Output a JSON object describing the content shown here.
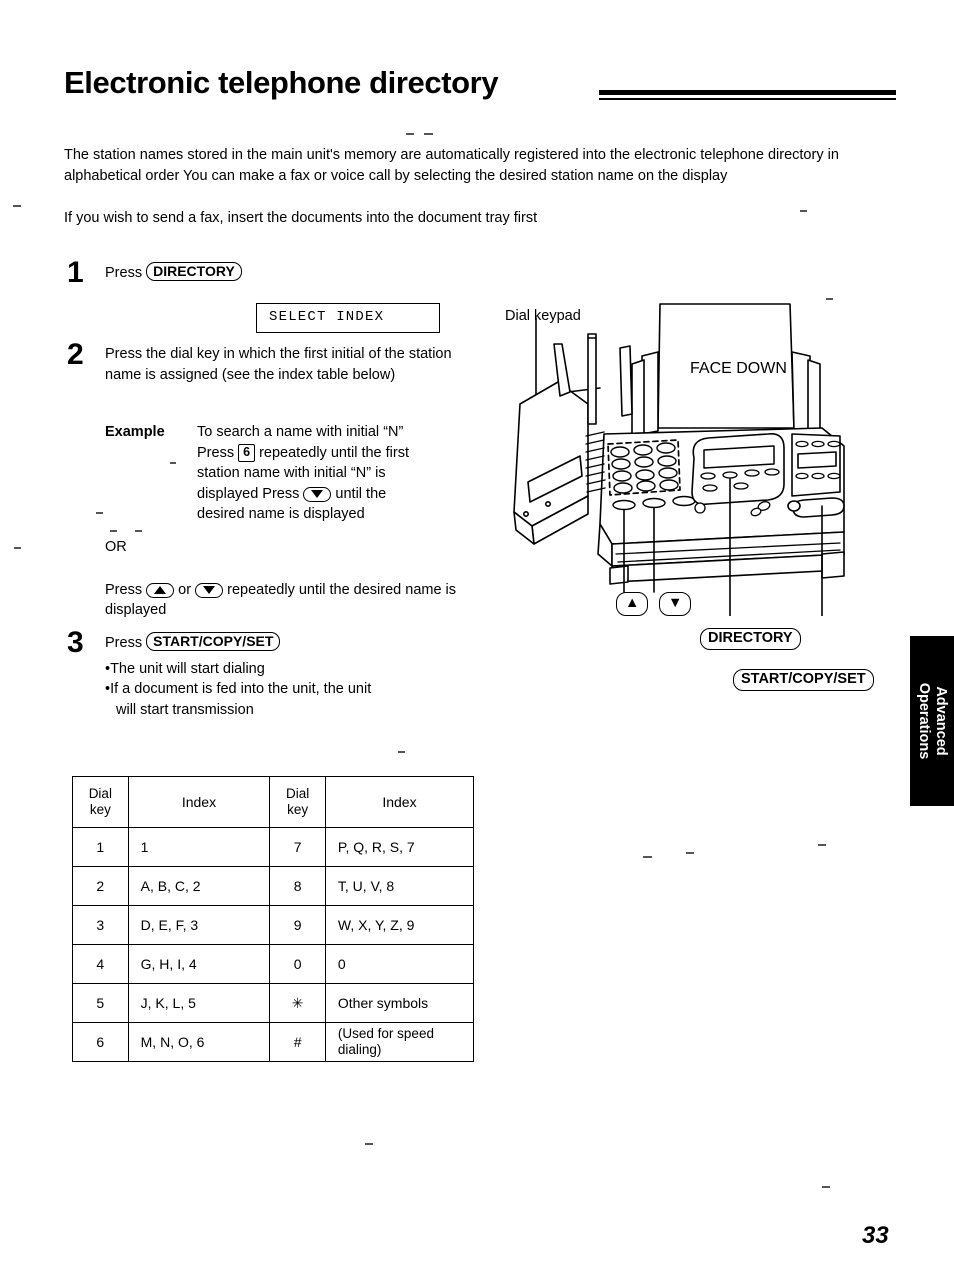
{
  "document": {
    "title": "Electronic telephone directory",
    "page_number": "33",
    "side_tab": {
      "line1": "Advanced",
      "line2": "Operations"
    }
  },
  "intro": {
    "paragraph1": "The station names stored in the main unit's memory are automatically registered into the electronic telephone directory in alphabetical order  You can make a fax or voice call by selecting the desired station name on the display",
    "paragraph2": "If you wish to send a fax, insert the documents into the document tray first"
  },
  "steps": {
    "step1": {
      "number": "1",
      "press_label": "Press",
      "button": "DIRECTORY",
      "lcd_text": "SELECT INDEX"
    },
    "step2": {
      "number": "2",
      "text": "Press the dial key in which the first initial of the station name is assigned (see the index table below)",
      "example_label": "Example",
      "example_line1_a": "To search a name with initial",
      "example_quote_n": "“N”",
      "example_line2_a": "Press",
      "example_key": "6",
      "example_line2_b": "repeatedly until the first",
      "example_line3": "station name with initial “N” is",
      "example_line4_a": "displayed  Press",
      "example_line4_b": "until the",
      "example_line5": "desired name is displayed",
      "or_word": "OR",
      "or_press": "Press",
      "or_joiner": "or",
      "or_tail": "repeatedly until the desired name is displayed"
    },
    "step3": {
      "number": "3",
      "press_label": "Press",
      "button": "START/COPY/SET",
      "bullet1": "•The unit will start dialing",
      "bullet2": "•If a document is fed into the unit, the unit",
      "bullet2_cont": "will start transmission"
    }
  },
  "index_table": {
    "headers": [
      "Dial key",
      "Index",
      "Dial key",
      "Index"
    ],
    "header_key_line1": "Dial",
    "header_key_line2": "key",
    "header_index": "Index",
    "rows": [
      {
        "key_left": "1",
        "index_left": "1",
        "key_right": "7",
        "index_right": "P, Q, R, S, 7"
      },
      {
        "key_left": "2",
        "index_left": "A, B, C, 2",
        "key_right": "8",
        "index_right": "T, U, V, 8"
      },
      {
        "key_left": "3",
        "index_left": "D, E, F, 3",
        "key_right": "9",
        "index_right": "W, X, Y, Z, 9"
      },
      {
        "key_left": "4",
        "index_left": "G, H, I, 4",
        "key_right": "0",
        "index_right": "0"
      },
      {
        "key_left": "5",
        "index_left": "J, K, L, 5",
        "key_right": "✳",
        "index_right": "Other symbols"
      },
      {
        "key_left": "6",
        "index_left": "M, N, O, 6",
        "key_right": "#",
        "index_right_line1": "(Used for speed",
        "index_right_line2": "dialing)"
      }
    ]
  },
  "illustration": {
    "dial_keypad_label": "Dial keypad",
    "face_down_label": "FACE DOWN",
    "callout_up": "▲",
    "callout_down": "▼",
    "callout_directory": "DIRECTORY",
    "callout_startcopyset": "START/COPY/SET"
  }
}
